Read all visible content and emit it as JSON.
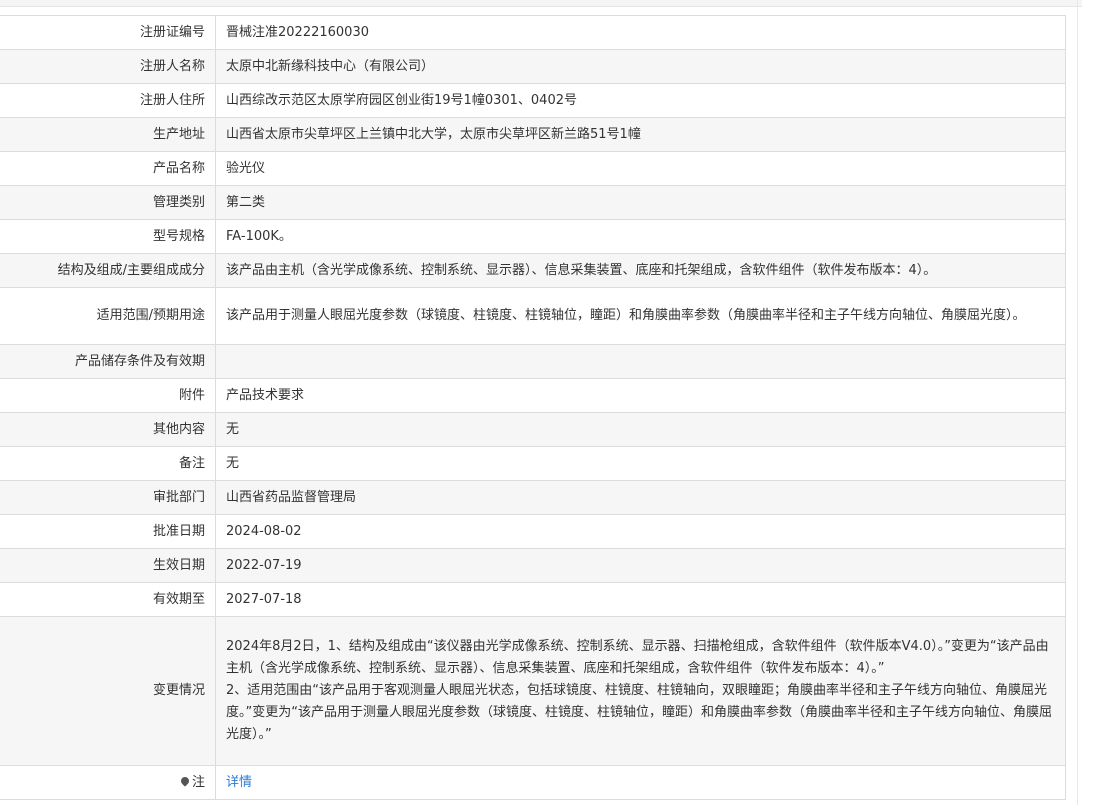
{
  "rows": [
    {
      "label": "注册证编号",
      "value": "晋械注准20222160030"
    },
    {
      "label": "注册人名称",
      "value": "太原中北新缘科技中心（有限公司）"
    },
    {
      "label": "注册人住所",
      "value": "山西综改示范区太原学府园区创业街19号1幢0301、0402号"
    },
    {
      "label": "生产地址",
      "value": "山西省太原市尖草坪区上兰镇中北大学，太原市尖草坪区新兰路51号1幢"
    },
    {
      "label": "产品名称",
      "value": "验光仪"
    },
    {
      "label": "管理类别",
      "value": "第二类"
    },
    {
      "label": "型号规格",
      "value": "FA-100K。"
    },
    {
      "label": "结构及组成/主要组成成分",
      "value": "该产品由主机（含光学成像系统、控制系统、显示器）、信息采集装置、底座和托架组成，含软件组件（软件发布版本：4）。"
    },
    {
      "label": "适用范围/预期用途",
      "value": "该产品用于测量人眼屈光度参数（球镜度、柱镜度、柱镜轴位，瞳距）和角膜曲率参数（角膜曲率半径和主子午线方向轴位、角膜屈光度）。"
    },
    {
      "label": "产品储存条件及有效期",
      "value": ""
    },
    {
      "label": "附件",
      "value": "产品技术要求"
    },
    {
      "label": "其他内容",
      "value": "无"
    },
    {
      "label": "备注",
      "value": "无"
    },
    {
      "label": "审批部门",
      "value": "山西省药品监督管理局"
    },
    {
      "label": "批准日期",
      "value": "2024-08-02"
    },
    {
      "label": "生效日期",
      "value": "2022-07-19"
    },
    {
      "label": "有效期至",
      "value": "2027-07-18"
    }
  ],
  "change": {
    "label": "变更情况",
    "para1": "2024年8月2日，1、结构及组成由“该仪器由光学成像系统、控制系统、显示器、扫描枪组成，含软件组件（软件版本V4.0）。”变更为“该产品由主机（含光学成像系统、控制系统、显示器）、信息采集装置、底座和托架组成，含软件组件（软件发布版本：4）。”",
    "para2": "2、适用范围由“该产品用于客观测量人眼屈光状态，包括球镜度、柱镜度、柱镜轴向，双眼瞳距；角膜曲率半径和主子午线方向轴位、角膜屈光度。”变更为“该产品用于测量人眼屈光度参数（球镜度、柱镜度、柱镜轴位，瞳距）和角膜曲率参数（角膜曲率半径和主子午线方向轴位、角膜屈光度）。”"
  },
  "note": {
    "label": "注",
    "icon": "pin-icon",
    "link_text": "详情"
  }
}
